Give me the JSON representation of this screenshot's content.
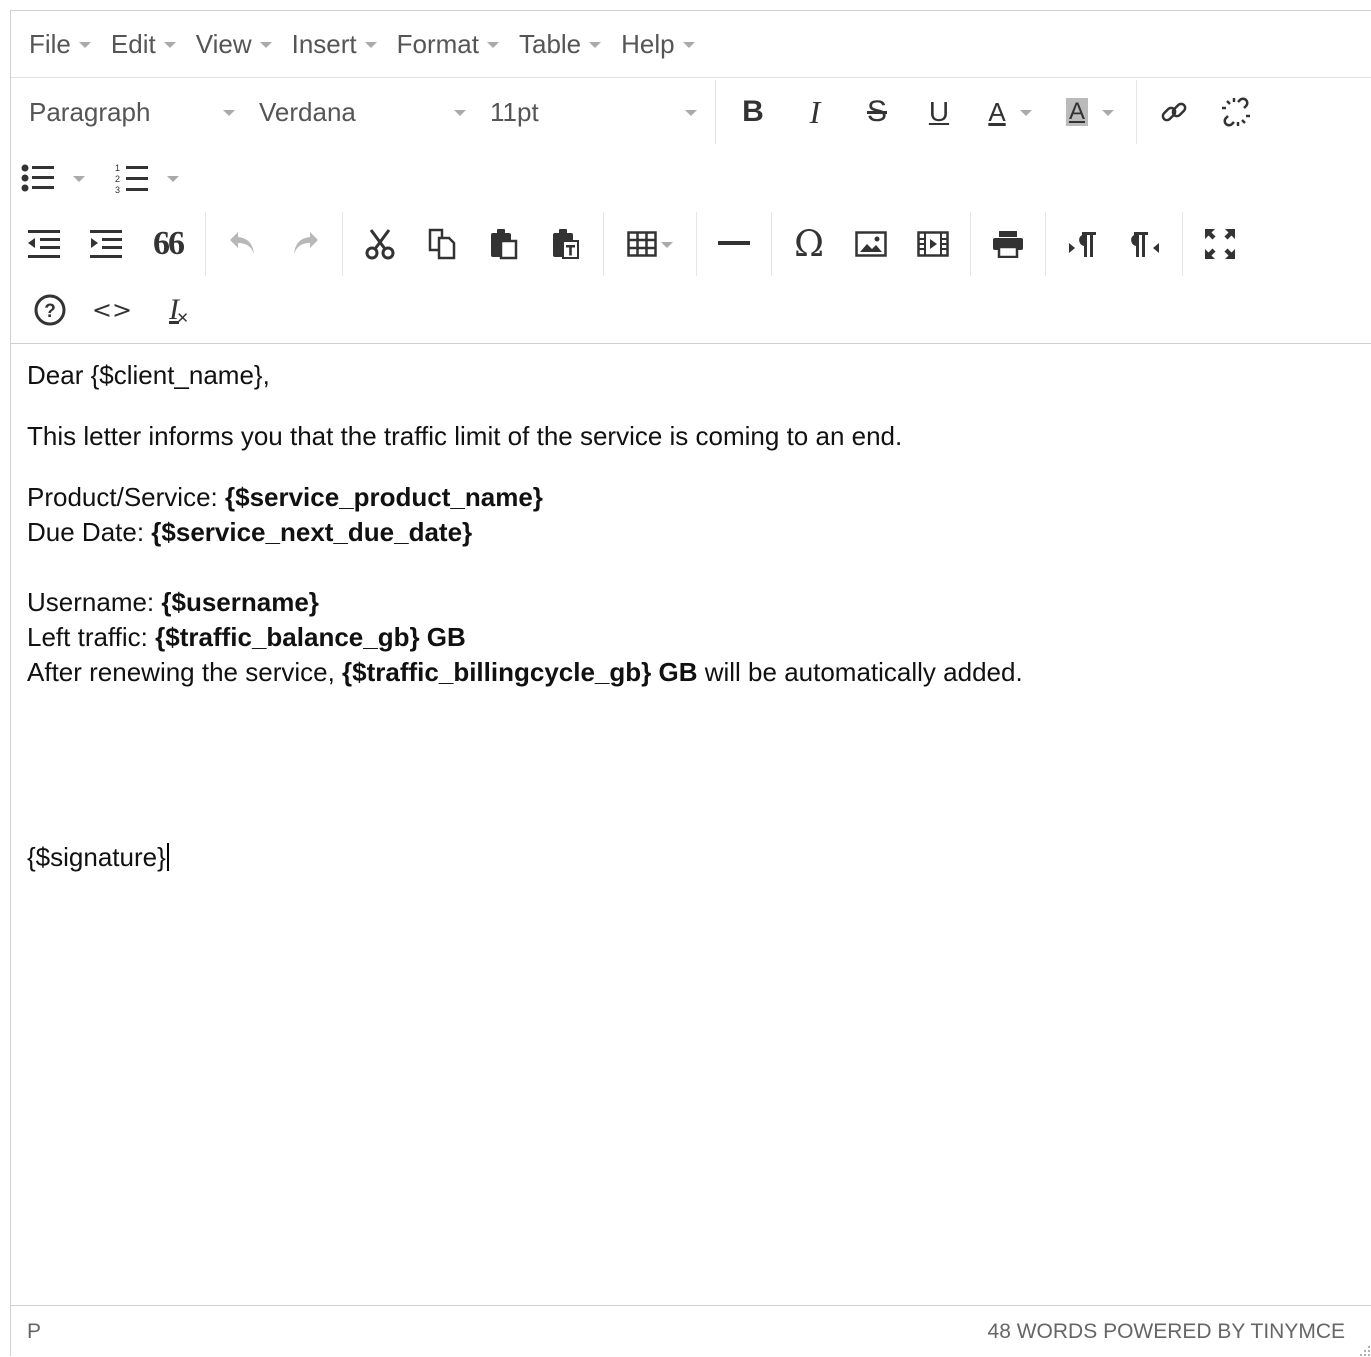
{
  "menubar": {
    "items": [
      {
        "label": "File"
      },
      {
        "label": "Edit"
      },
      {
        "label": "View"
      },
      {
        "label": "Insert"
      },
      {
        "label": "Format"
      },
      {
        "label": "Table"
      },
      {
        "label": "Help"
      }
    ]
  },
  "toolbar": {
    "block_format": "Paragraph",
    "font_family": "Verdana",
    "font_size": "11pt",
    "bold_label": "B",
    "italic_label": "I",
    "strike_label": "S",
    "underline_label": "U",
    "text_color_label": "A",
    "bg_color_label": "A",
    "blockquote_label": "66",
    "special_char_label": "Ω",
    "code_label": "<>",
    "clear_format_label": "I"
  },
  "document": {
    "greeting": "Dear {$client_name},",
    "intro": "This letter informs you that the traffic limit of the service is coming to an end.",
    "product_label": "Product/Service: ",
    "product_value": "{$service_product_name}",
    "due_label": "Due Date: ",
    "due_value": "{$service_next_due_date}",
    "username_label": "Username: ",
    "username_value": "{$username}",
    "left_label": "Left traffic: ",
    "left_value": "{$traffic_balance_gb} GB",
    "renew_prefix": "After renewing the service, ",
    "renew_value": "{$traffic_billingcycle_gb} GB",
    "renew_suffix": " will be automatically added.",
    "signature": "{$signature}"
  },
  "statusbar": {
    "path": "P",
    "info": "48 WORDS POWERED BY TINYMCE"
  },
  "colors": {
    "border": "#d0d0d0",
    "icon": "#333333",
    "muted_text": "#555555",
    "caret": "#aaaaaa"
  }
}
